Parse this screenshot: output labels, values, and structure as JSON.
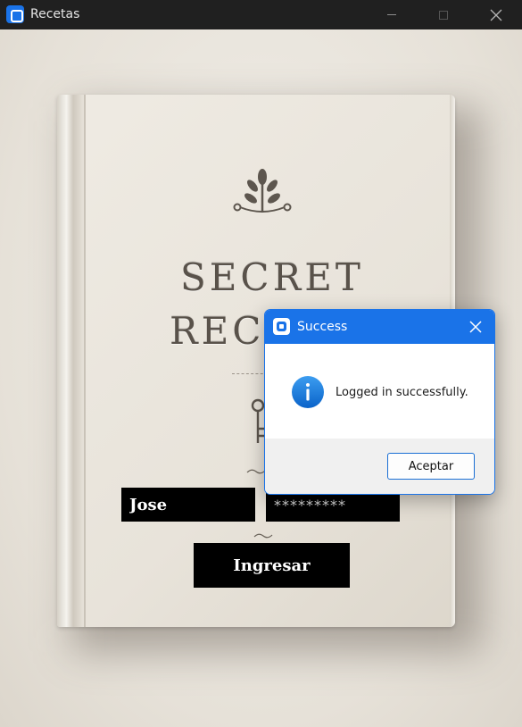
{
  "window": {
    "title": "Recetas"
  },
  "cover": {
    "line1": "SECRET",
    "line2": "RECI"
  },
  "login": {
    "username_value": "Jose",
    "password_masked": "*********",
    "submit_label": "Ingresar"
  },
  "dialog": {
    "title": "Success",
    "message": "Logged in successfully.",
    "ok_label": "Aceptar",
    "icon": "info-icon"
  },
  "colors": {
    "accent": "#1a73e8",
    "titlebar": "#202020",
    "input_bg": "#000000"
  }
}
